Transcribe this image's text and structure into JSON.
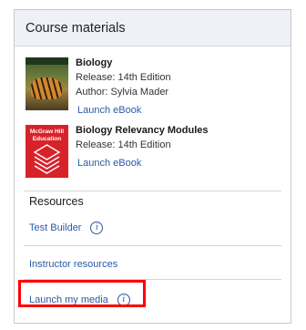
{
  "panel": {
    "title": "Course materials"
  },
  "books": [
    {
      "title": "Biology",
      "release": "Release: 14th Edition",
      "author": "Author: Sylvia Mader",
      "launch_label": "Launch eBook"
    },
    {
      "title": "Biology Relevancy Modules",
      "release": "Release: 14th Edition",
      "launch_label": "Launch eBook",
      "cover_text": [
        "McGraw Hill",
        "Education"
      ]
    }
  ],
  "resources": {
    "heading": "Resources",
    "links": [
      {
        "label": "Test Builder",
        "icon": "info-icon"
      },
      {
        "label": "Instructor resources"
      },
      {
        "label": "Launch my media",
        "icon": "info-icon"
      }
    ]
  },
  "colors": {
    "link": "#2a5aa8",
    "header_bg": "#eef2f8",
    "highlight": "#ff0000",
    "brand_red": "#d8222a"
  }
}
